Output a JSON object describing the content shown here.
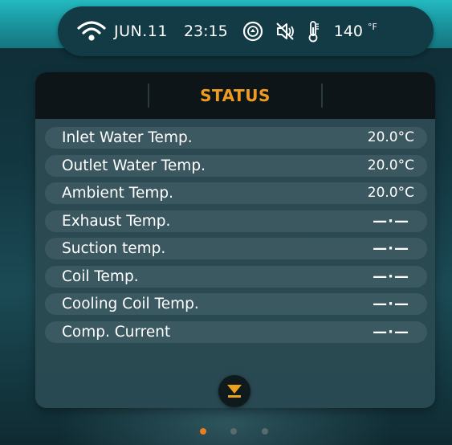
{
  "status_bar": {
    "date": "JUN.11",
    "time": "23:15",
    "temperature": "140",
    "temperature_unit": "°F",
    "icons": [
      "wifi-icon",
      "circulation-icon",
      "muted-speaker-icon",
      "thermometer-icon"
    ]
  },
  "panel": {
    "title": "STATUS",
    "rows": [
      {
        "label": "Inlet Water Temp.",
        "value": "20.0°C"
      },
      {
        "label": "Outlet Water Temp.",
        "value": "20.0°C"
      },
      {
        "label": "Ambient Temp.",
        "value": "20.0°C"
      },
      {
        "label": "Exhaust Temp.",
        "value": "—·—"
      },
      {
        "label": "Suction temp.",
        "value": "—·—"
      },
      {
        "label": "Coil Temp.",
        "value": "—·—"
      },
      {
        "label": "Cooling Coil Temp.",
        "value": "—·—"
      },
      {
        "label": "Comp. Current",
        "value": "—·—"
      }
    ],
    "scroll_button_icon": "chevron-down-icon"
  },
  "pagination": {
    "page_count": 3,
    "active_page": 1,
    "active_color": "#ee7c1b",
    "inactive_color": "#5a6a6e"
  },
  "colors": {
    "accent": "#ee9b1f",
    "teal": "#1fb0b8"
  }
}
